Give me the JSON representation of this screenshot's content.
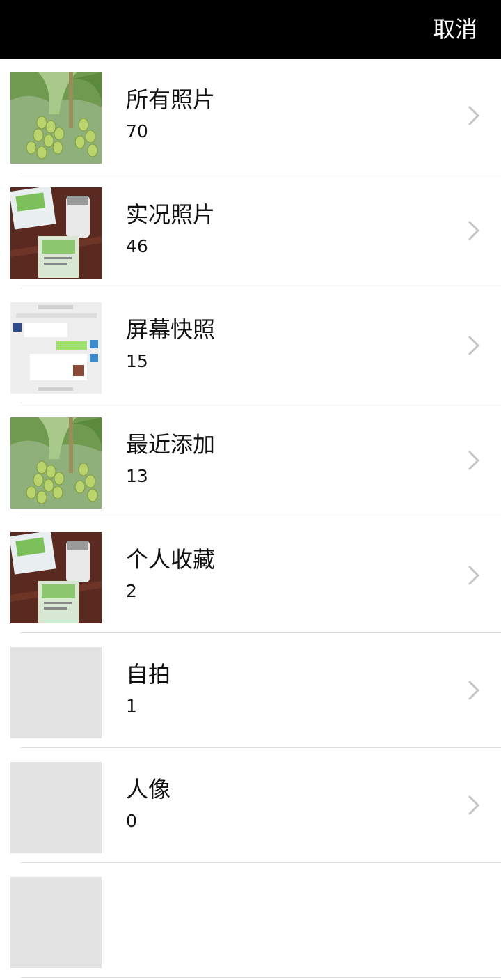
{
  "header": {
    "cancel_label": "取消"
  },
  "albums": [
    {
      "title": "所有照片",
      "count": "70",
      "thumbnail": "grape-cluster-photo"
    },
    {
      "title": "实况照片",
      "count": "46",
      "thumbnail": "product-packet-photo"
    },
    {
      "title": "屏幕快照",
      "count": "15",
      "thumbnail": "chat-screenshot"
    },
    {
      "title": "最近添加",
      "count": "13",
      "thumbnail": "grape-cluster-photo"
    },
    {
      "title": "个人收藏",
      "count": "2",
      "thumbnail": "product-packet-photo"
    },
    {
      "title": "自拍",
      "count": "1",
      "thumbnail": "empty-placeholder"
    },
    {
      "title": "人像",
      "count": "0",
      "thumbnail": "empty-placeholder"
    },
    {
      "title": "",
      "count": "",
      "thumbnail": "empty-placeholder"
    }
  ],
  "colors": {
    "header_bg": "#000000",
    "header_text": "#ffffff",
    "separator": "#dcdcdc",
    "chevron": "#c4c4c4",
    "placeholder": "#e3e3e3"
  }
}
